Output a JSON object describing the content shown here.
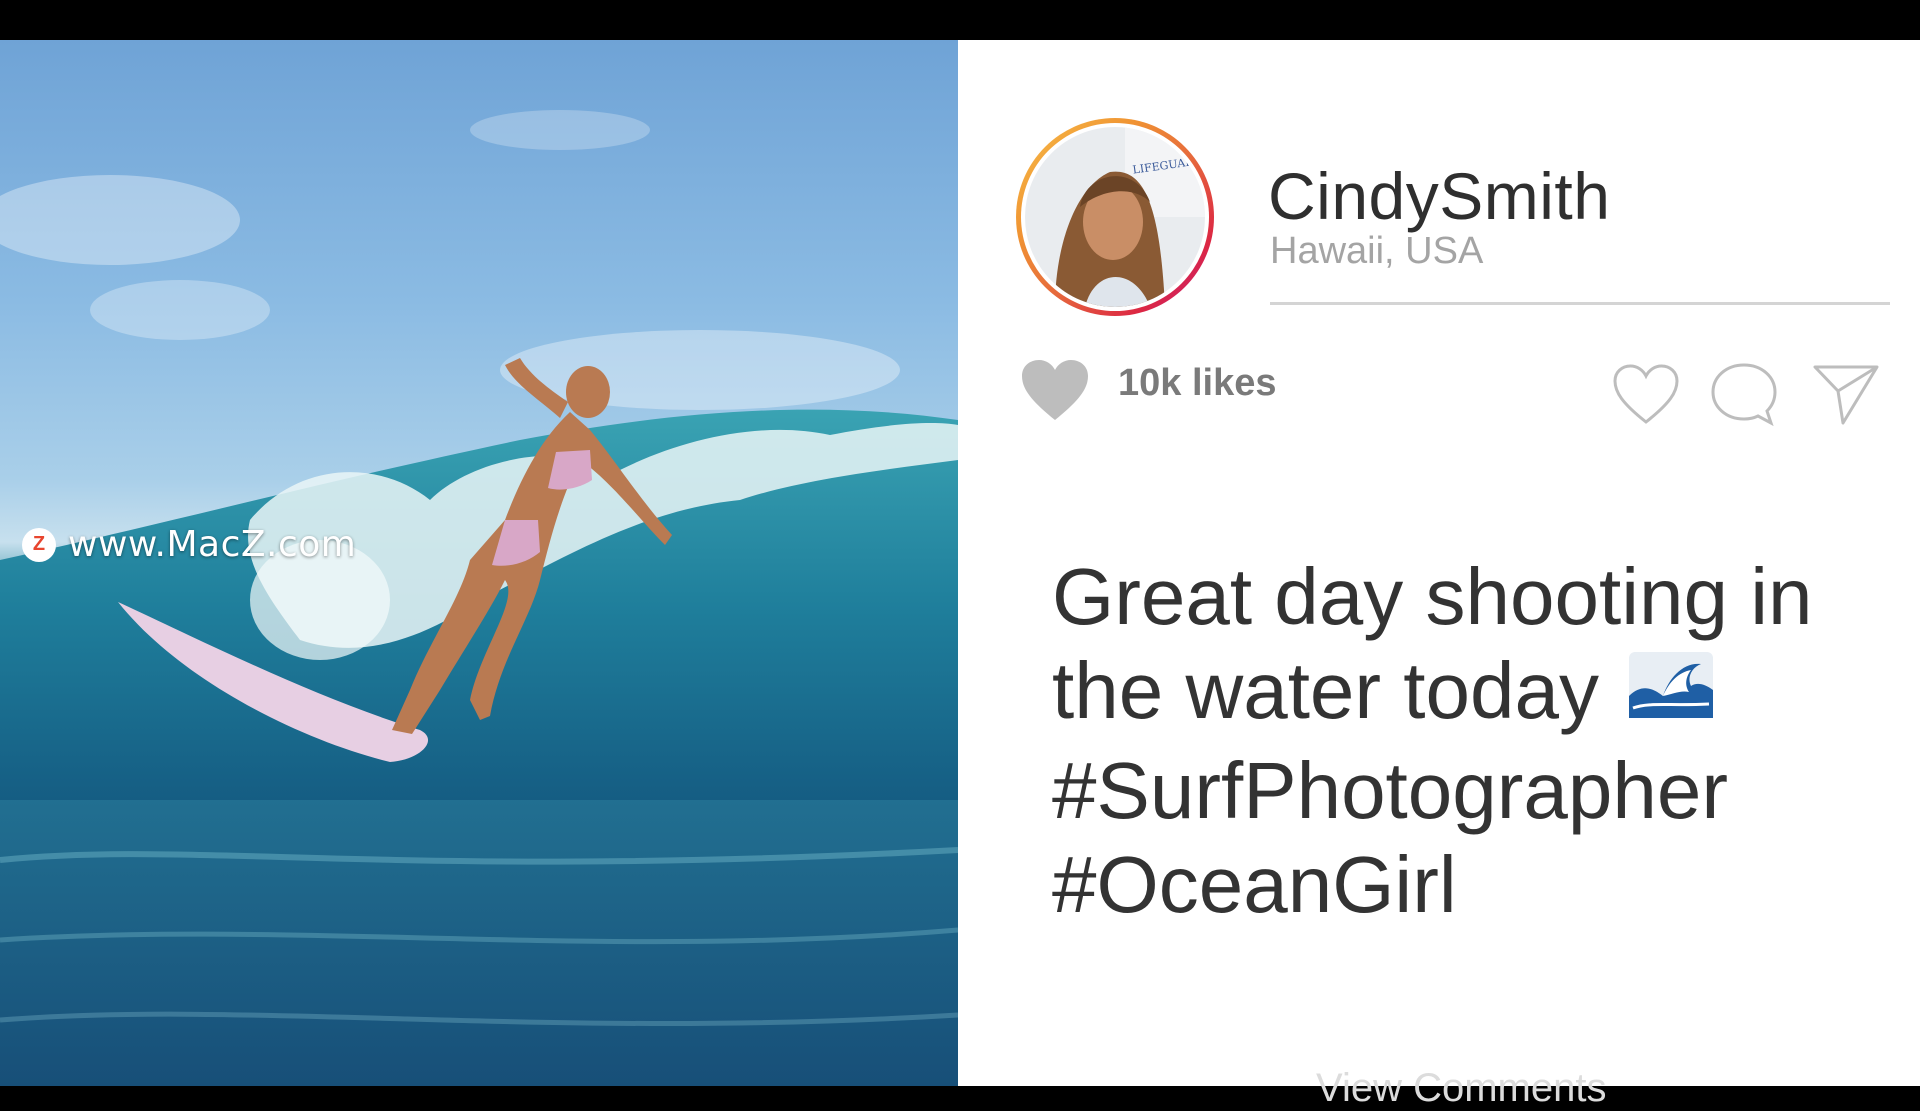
{
  "watermark": {
    "logo_letter": "Z",
    "text": "www.MacZ.com"
  },
  "post": {
    "username": "CindySmith",
    "location": "Hawaii, USA",
    "likes_label": "10k likes",
    "caption_lines": [
      "Great day shooting in",
      "the water today",
      "#SurfPhotographer",
      "#OceanGirl"
    ],
    "caption_emoji": "wave-emoji",
    "view_comments": "View Comments",
    "avatar_sign_text": "LIFEGUARD ON DUTY"
  },
  "icons": {
    "likes_heart": "heart-filled-icon",
    "actions": [
      "heart-outline-icon",
      "comment-icon",
      "send-icon"
    ]
  },
  "colors": {
    "avatar_ring_start": "#f7c04a",
    "avatar_ring_end": "#bc1888",
    "text_dark": "#2f2f2f",
    "text_muted": "#a4a4a4",
    "icon_gray": "#bdbdbd"
  }
}
